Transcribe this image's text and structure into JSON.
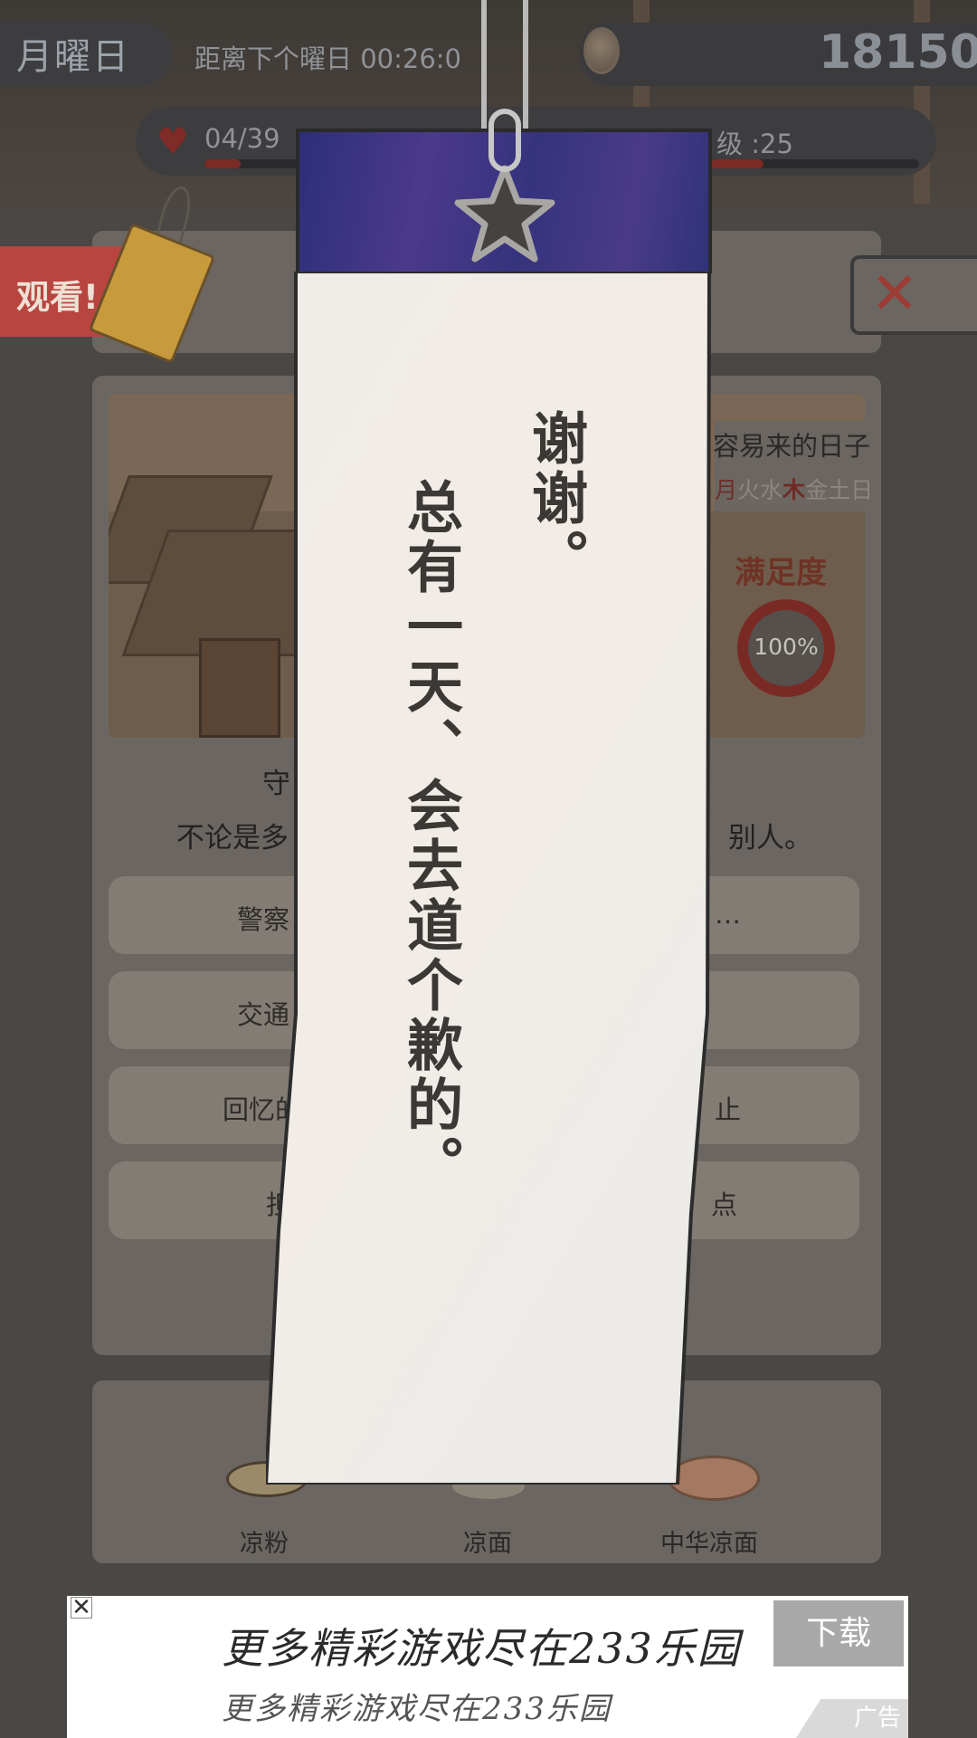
{
  "hud": {
    "day": "月曜日",
    "next_day_timer": "距离下个曜日  00:26:0",
    "coins": "18150",
    "hearts": "04/39",
    "hearts_fill": 0.04,
    "level": "级 :25",
    "level_fill": 0.25
  },
  "watch_tab": {
    "label": "观看!"
  },
  "close_button": {
    "symbol": "✕"
  },
  "shop_card": {
    "name": "容易来的日子",
    "weekdays": [
      {
        "char": "月",
        "style": "red"
      },
      {
        "char": "火",
        "style": "normal"
      },
      {
        "char": "水",
        "style": "normal"
      },
      {
        "char": "木",
        "style": "highlight"
      },
      {
        "char": "金",
        "style": "normal"
      },
      {
        "char": "土",
        "style": "normal"
      },
      {
        "char": "日",
        "style": "normal"
      }
    ],
    "satisfaction_label": "满足度",
    "satisfaction_value": "100%",
    "description_line1": "守",
    "description_line2_left": "不论是多",
    "description_line2_right": "别人。"
  },
  "options": [
    {
      "left": "警察",
      "right": "…"
    },
    {
      "left": "交通",
      "right": ""
    },
    {
      "left": "回忆的",
      "right": "止"
    },
    {
      "left": "担",
      "right": "点"
    }
  ],
  "foods": [
    {
      "name": "凉粉"
    },
    {
      "name": "凉面"
    },
    {
      "name": "中华凉面"
    }
  ],
  "tanzaku": {
    "line_right": "谢谢。",
    "line_left": "总有一天、会去道个歉的。"
  },
  "ad": {
    "close": "✕",
    "title": "更多精彩游戏尽在233乐园",
    "subtitle": "更多精彩游戏尽在233乐园",
    "download": "下载",
    "badge": "广告"
  },
  "colors": {
    "tanzaku_top": "#36337d",
    "accent_red": "#b8453f",
    "satisfaction_ring": "#7a2a25"
  }
}
